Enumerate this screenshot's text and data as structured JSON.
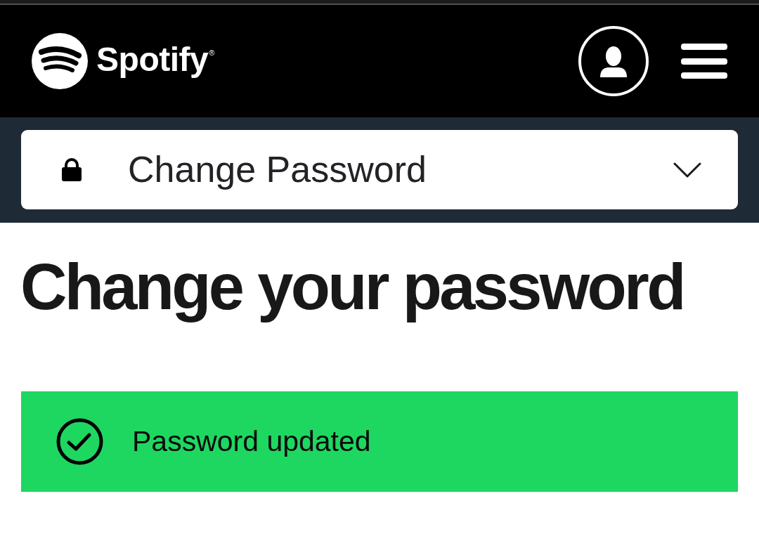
{
  "header": {
    "logo_text": "Spotify$^{®}$"
  },
  "section_dropdown": {
    "label": "Change Password",
    "expanded": false
  },
  "page_title": "Change your password",
  "alert": {
    "kind": "success",
    "message": "Password updated"
  }
}
